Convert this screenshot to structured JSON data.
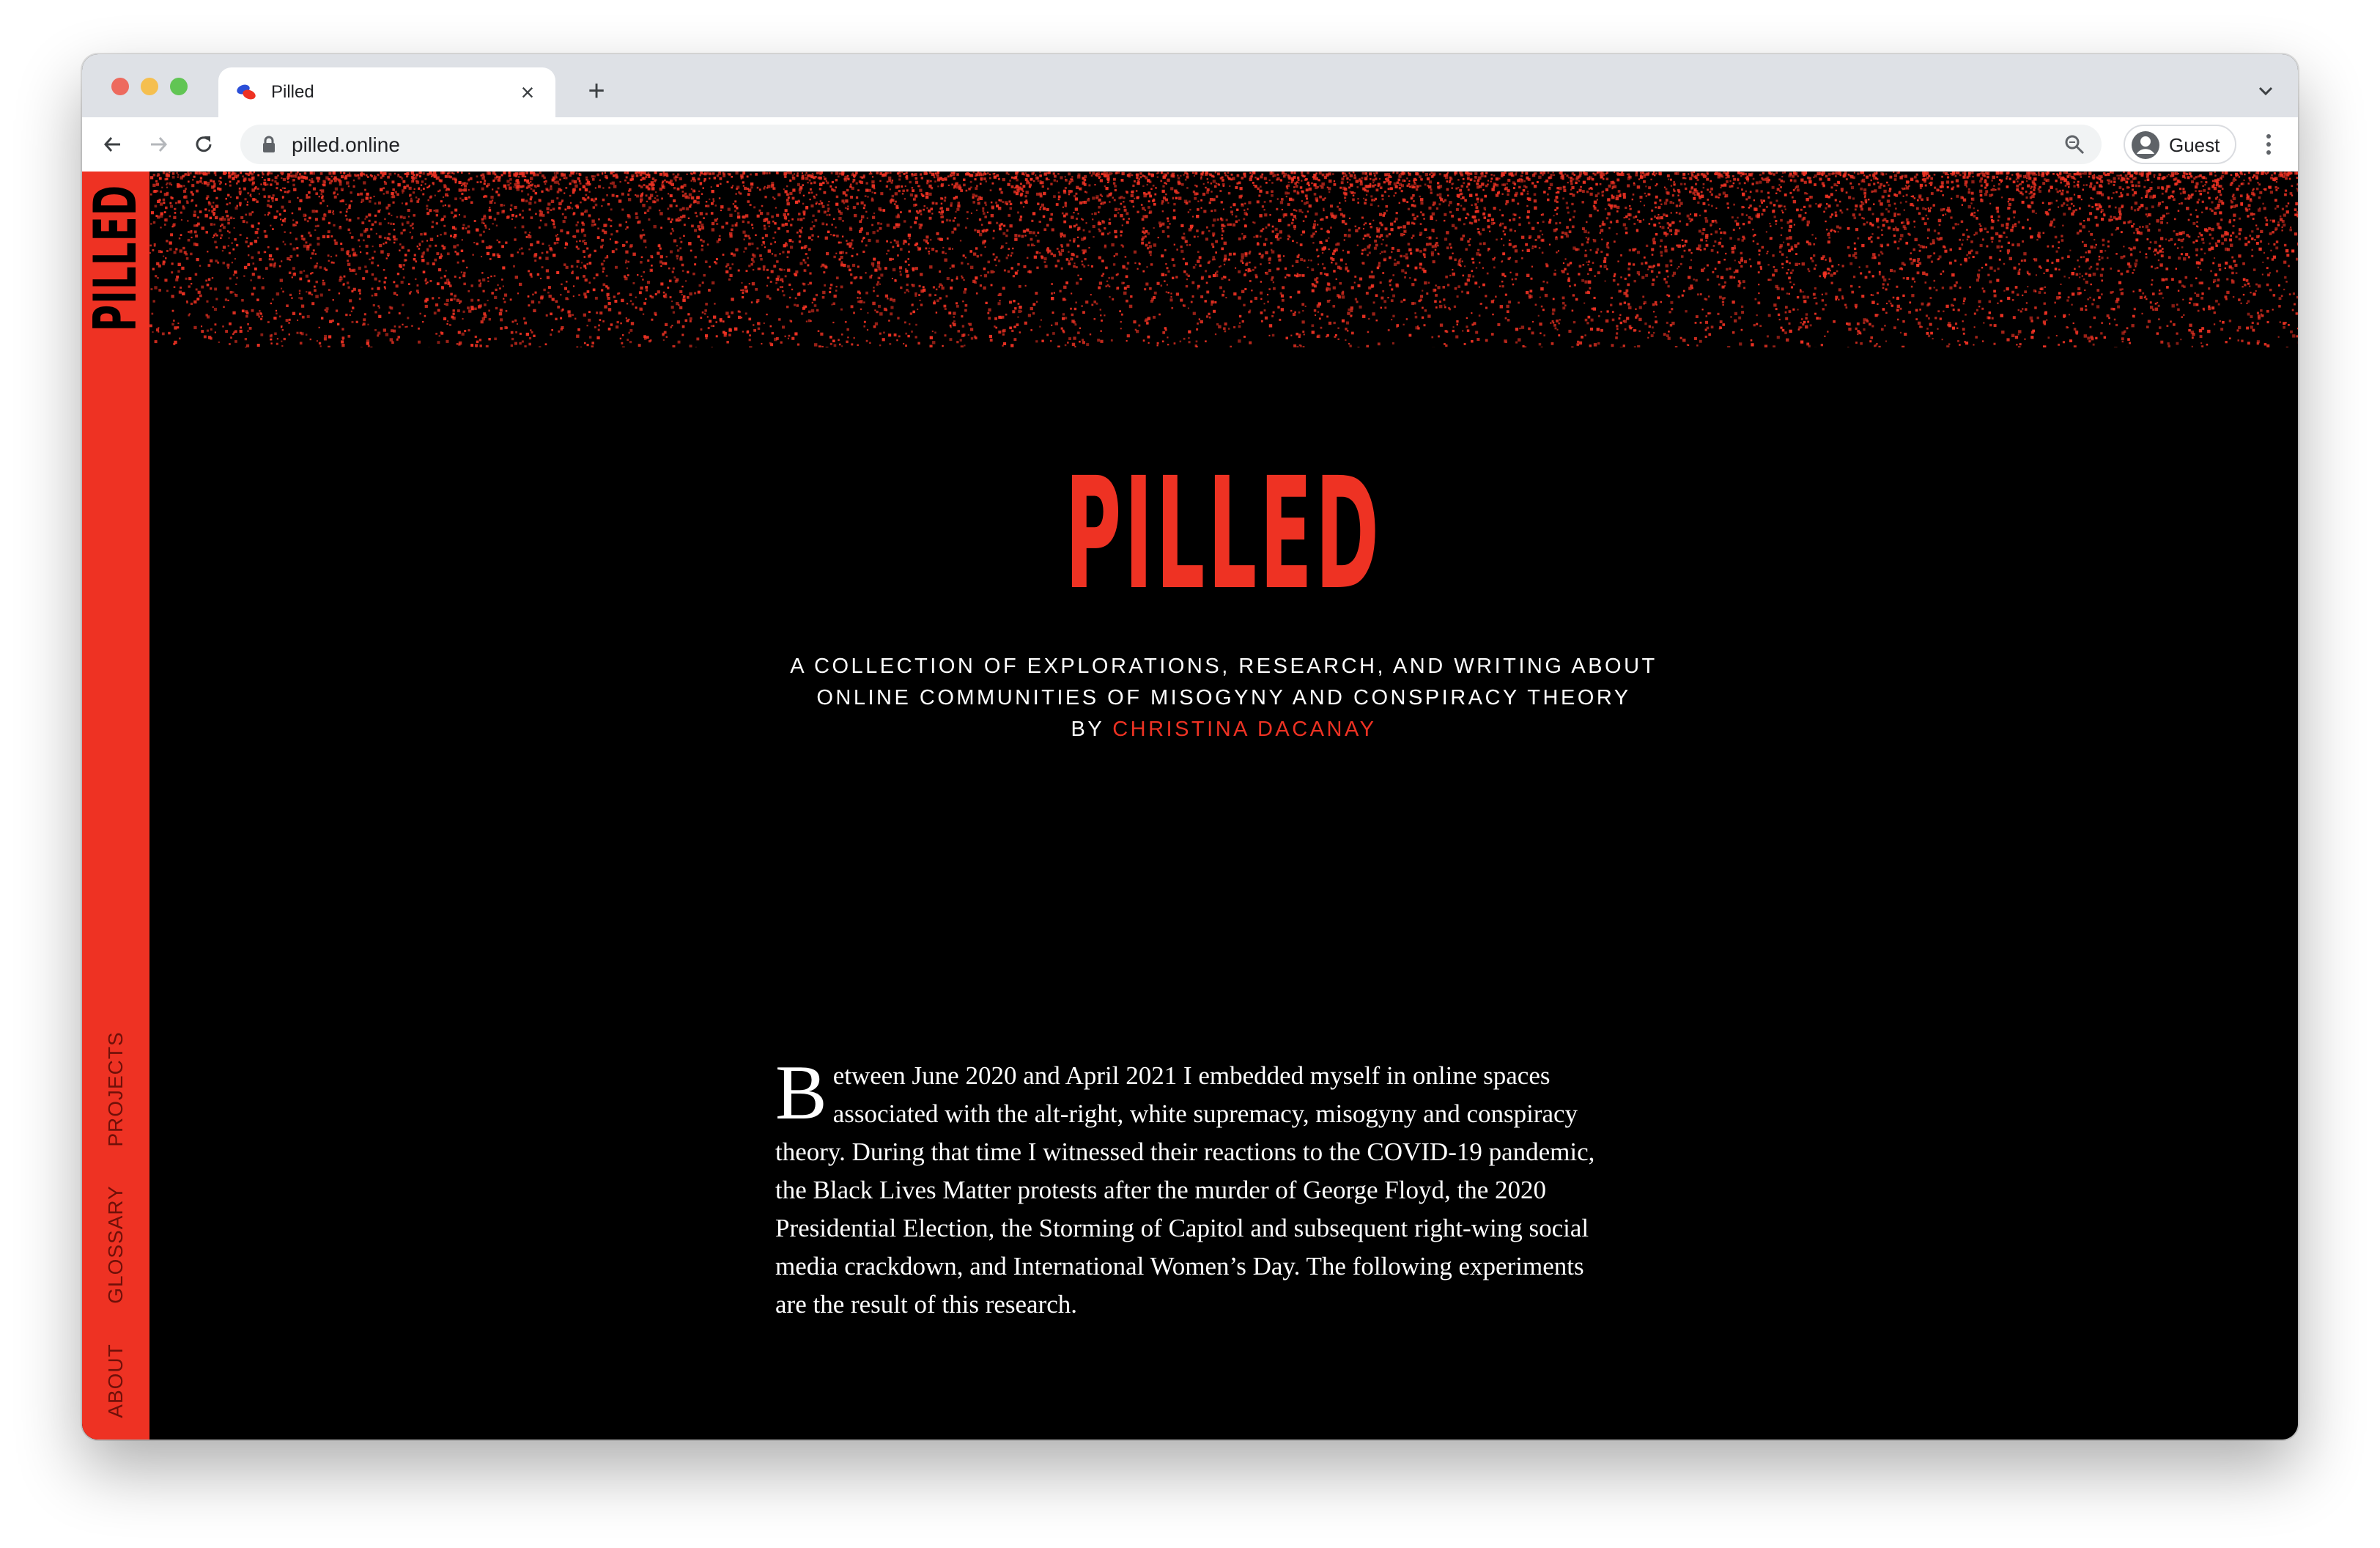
{
  "browser": {
    "tab_title": "Pilled",
    "tab_close": "×",
    "new_tab": "+",
    "url": "pilled.online",
    "profile_label": "Guest"
  },
  "sidebar": {
    "logo": "PILLED",
    "links": [
      "PROJECTS",
      "GLOSSARY",
      "ABOUT"
    ]
  },
  "hero": {
    "title": "PILLED",
    "subtitle_line1": "A COLLECTION OF EXPLORATIONS, RESEARCH, AND WRITING ABOUT",
    "subtitle_line2": "ONLINE COMMUNITIES OF MISOGYNY AND CONSPIRACY THEORY",
    "by": "BY ",
    "author": "CHRISTINA DACANAY"
  },
  "intro": {
    "dropcap": "B",
    "text": "etween June 2020 and April 2021 I embedded myself in online spaces associated with the alt-right, white supremacy, misogyny and conspiracy theory. During that time I witnessed their reactions to the COVID-19 pandemic, the Black Lives Matter protests after the murder of George Floyd, the 2020 Presidential Election, the Storming of Capitol and subsequent right-wing social media crackdown, and International Women’s Day. The following experiments are the result of this research."
  },
  "colors": {
    "accent": "#ee3223",
    "background": "#000000",
    "text": "#ffffff"
  }
}
